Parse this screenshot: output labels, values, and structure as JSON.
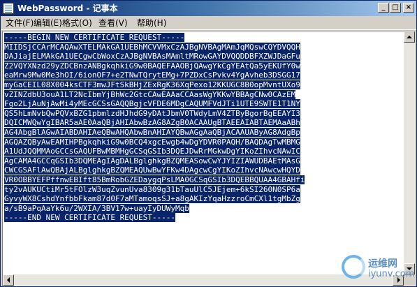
{
  "window": {
    "title": "WebPassword - 记事本",
    "controls": {
      "minimize": "_",
      "maximize": "□",
      "close": "×"
    }
  },
  "menu": [
    {
      "label": "文件(F)"
    },
    {
      "label": "编辑(E)"
    },
    {
      "label": "格式(O)"
    },
    {
      "label": "查看(V)"
    },
    {
      "label": "帮助(H)"
    }
  ],
  "editor": {
    "lines": [
      "-----BEGIN NEW CERTIFICATE REQUEST-----",
      "MIIDSjCCArMCAQAwXTELMAkGA1UEBhMCVVMxCzAJBgNVBAgMAmJqMQswCQYDVQQH",
      "DAJiajELMAkGA1UECgwCbWoxCzAJBgNVBAsMAmltMRowGAYDVQQDDBFXZWJDaGFu",
      "Z2VQYXNzd29yZDCBnzANBgkqhkiG9w0BAQEFAAOBjQAwgYkCgYEAtQa5yEKUfY0w",
      "eaMrw9Mw0Me3hOI/6ionOF7+e2TNwTQrytEMg+7PZDxCsPvkv4YgAvheb3DSGG17",
      "myGaCEIL08X004ksCTF3mwJFtSkBHjZExRgK36XqPexo12KKUGC8B0opMvntUXo9",
      "vZINZdbU3ouA1LT2NcIbmYjBhWc2GtcCAwEAAaCCAasWgYKKwYBBAgCNw0CAzEM",
      "Fgo2LjAuNjAwMi4yMEcGCSsGAQQBgjcVFDE6MDgCAQUMFVdJTi1UTE9SWTE1T1NY",
      "QS5hLmNvbQwPQVxBZG1pbmlzdHJhdG9yDAtJbmV0TWdyLmV4ZTByBgorBgEEAYI3",
      "DQICMWQwYgIBAR5aAE0AaQBjAHIAbwBzAG8AZgB0ACAAUgBTAEEAIABTAEMAaABh",
      "AG4AbgBlAGwAIABDAHIAeQBwAHQAbwBnAHIAYQBwAGgAaQBjACAAUAByAG8AdgBp",
      "AGQAZQByAwEAMIHPBgkqhkiG9w0BCQ4xgcEwgb4wDgYDVR0PAQH/BAQDAgTwMBMG",
      "A1UdJQQMMAoGCCsGAQUFBwMBMHgGCSqGSIb3DQEJDwRrMGkwDgYIKoZIhvcNAwIC",
      "AgCAMA4GCCqGSIb3DQMEAgIAgDALBglghkgBZQMEASowCwYJYIZIAWUDBAEtMAsG",
      "CWCGSAFlAwQBAjALBglghkgBZQMEAQUwBwYFKw4DAgcwCgYIKoZIhvcNAwcwHQYD",
      "VR0OBBYEFPffnwEBIft85BmRobGZEDaygqPsLMA0GCSqGSIb3DQEBBQUAA4GBAHfi",
      "ty2vAUKUCtiMr5tFOlzW3uqZvunUva8309g31bTauUlC5JEjem+6kSI260N0SP6a",
      "GyvyWX8CshdYnfbbFkam87d0F7aMTamoqsSJ+a8gAKIzYqaHzzroCmCXl1tgMbZg",
      "a/sB9aPqAaYk6u/2WXIA/3BV17w+uayIyDUWyMqb",
      "-----END NEW CERTIFICATE REQUEST-----"
    ]
  },
  "watermark": {
    "cn": "运维网",
    "en": "iyunv.com"
  },
  "colors": {
    "selection": "#0a246a",
    "titlebar": "#0a246a",
    "chrome": "#d4d0c8"
  }
}
